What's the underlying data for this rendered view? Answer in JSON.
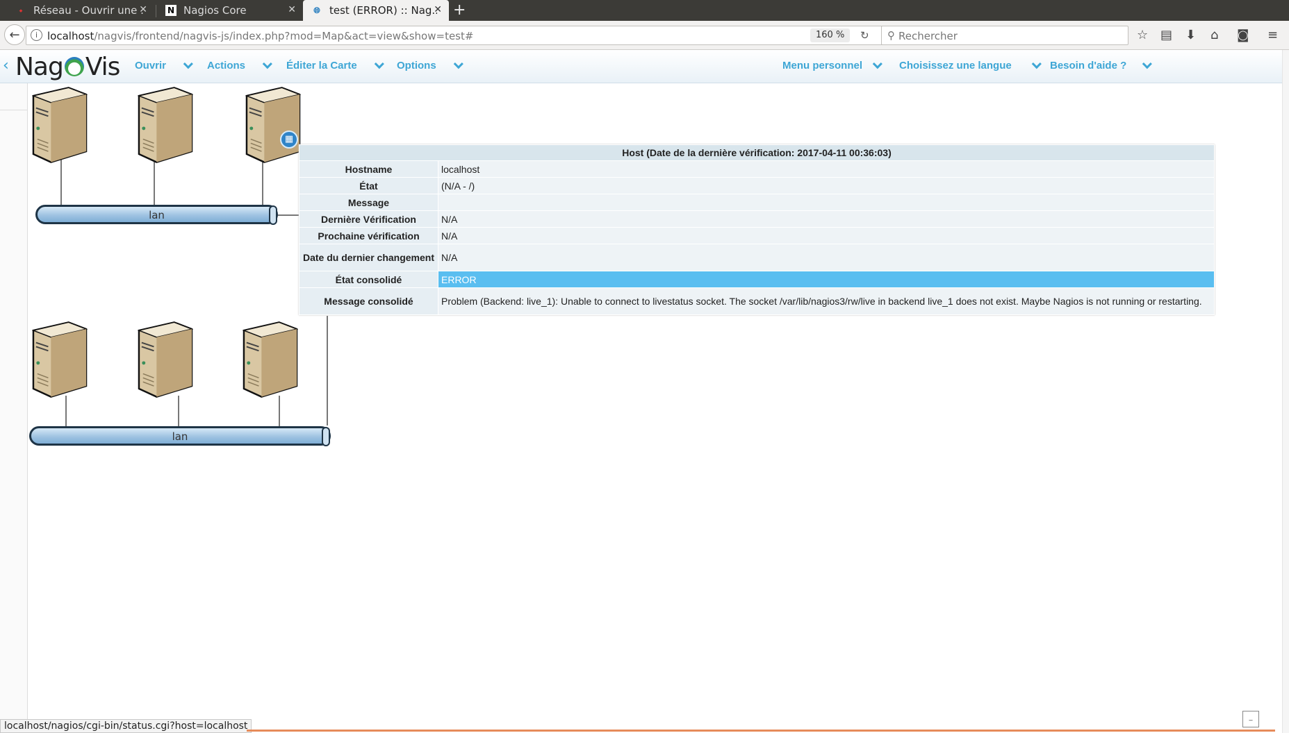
{
  "browser": {
    "tabs": [
      {
        "label": "Réseau - Ouvrir une ...",
        "icon": "pdf-icon",
        "active": false
      },
      {
        "label": "Nagios Core",
        "icon": "nagios-n-icon",
        "active": false
      },
      {
        "label": "test (ERROR) :: Nag...",
        "icon": "globe-icon",
        "active": true
      }
    ],
    "url_host": "localhost",
    "url_path": "/nagvis/frontend/nagvis-js/index.php?mod=Map&act=view&show=test#",
    "zoom": "160 %",
    "search_placeholder": "Rechercher",
    "status_url": "localhost/nagios/cgi-bin/status.cgi?host=localhost"
  },
  "nagvis": {
    "logo_left": "Nag",
    "logo_right": "Vis",
    "menu_left": [
      "Ouvrir",
      "Actions",
      "Éditer la Carte",
      "Options"
    ],
    "menu_right": [
      "Menu personnel",
      "Choisissez une langue",
      "Besoin d'aide ?"
    ]
  },
  "map": {
    "lan_top_label": "lan",
    "lan_bottom_label": "lan"
  },
  "hover": {
    "title": "Host (Date de la dernière vérification: 2017-04-11 00:36:03)",
    "rows": [
      {
        "label": "Hostname",
        "value": "localhost"
      },
      {
        "label": "État",
        "value": "(N/A - /)"
      },
      {
        "label": "Message",
        "value": ""
      },
      {
        "label": "Dernière Vérification",
        "value": "N/A"
      },
      {
        "label": "Prochaine vérification",
        "value": "N/A"
      },
      {
        "label": "Date du dernier changement",
        "value": "N/A"
      },
      {
        "label": "État consolidé",
        "value": "ERROR"
      },
      {
        "label": "Message consolidé",
        "value": "Problem (Backend: live_1): Unable to connect to livestatus socket. The socket /var/lib/nagios3/rw/live in backend live_1 does not exist. Maybe Nagios is not running or restarting."
      }
    ]
  }
}
